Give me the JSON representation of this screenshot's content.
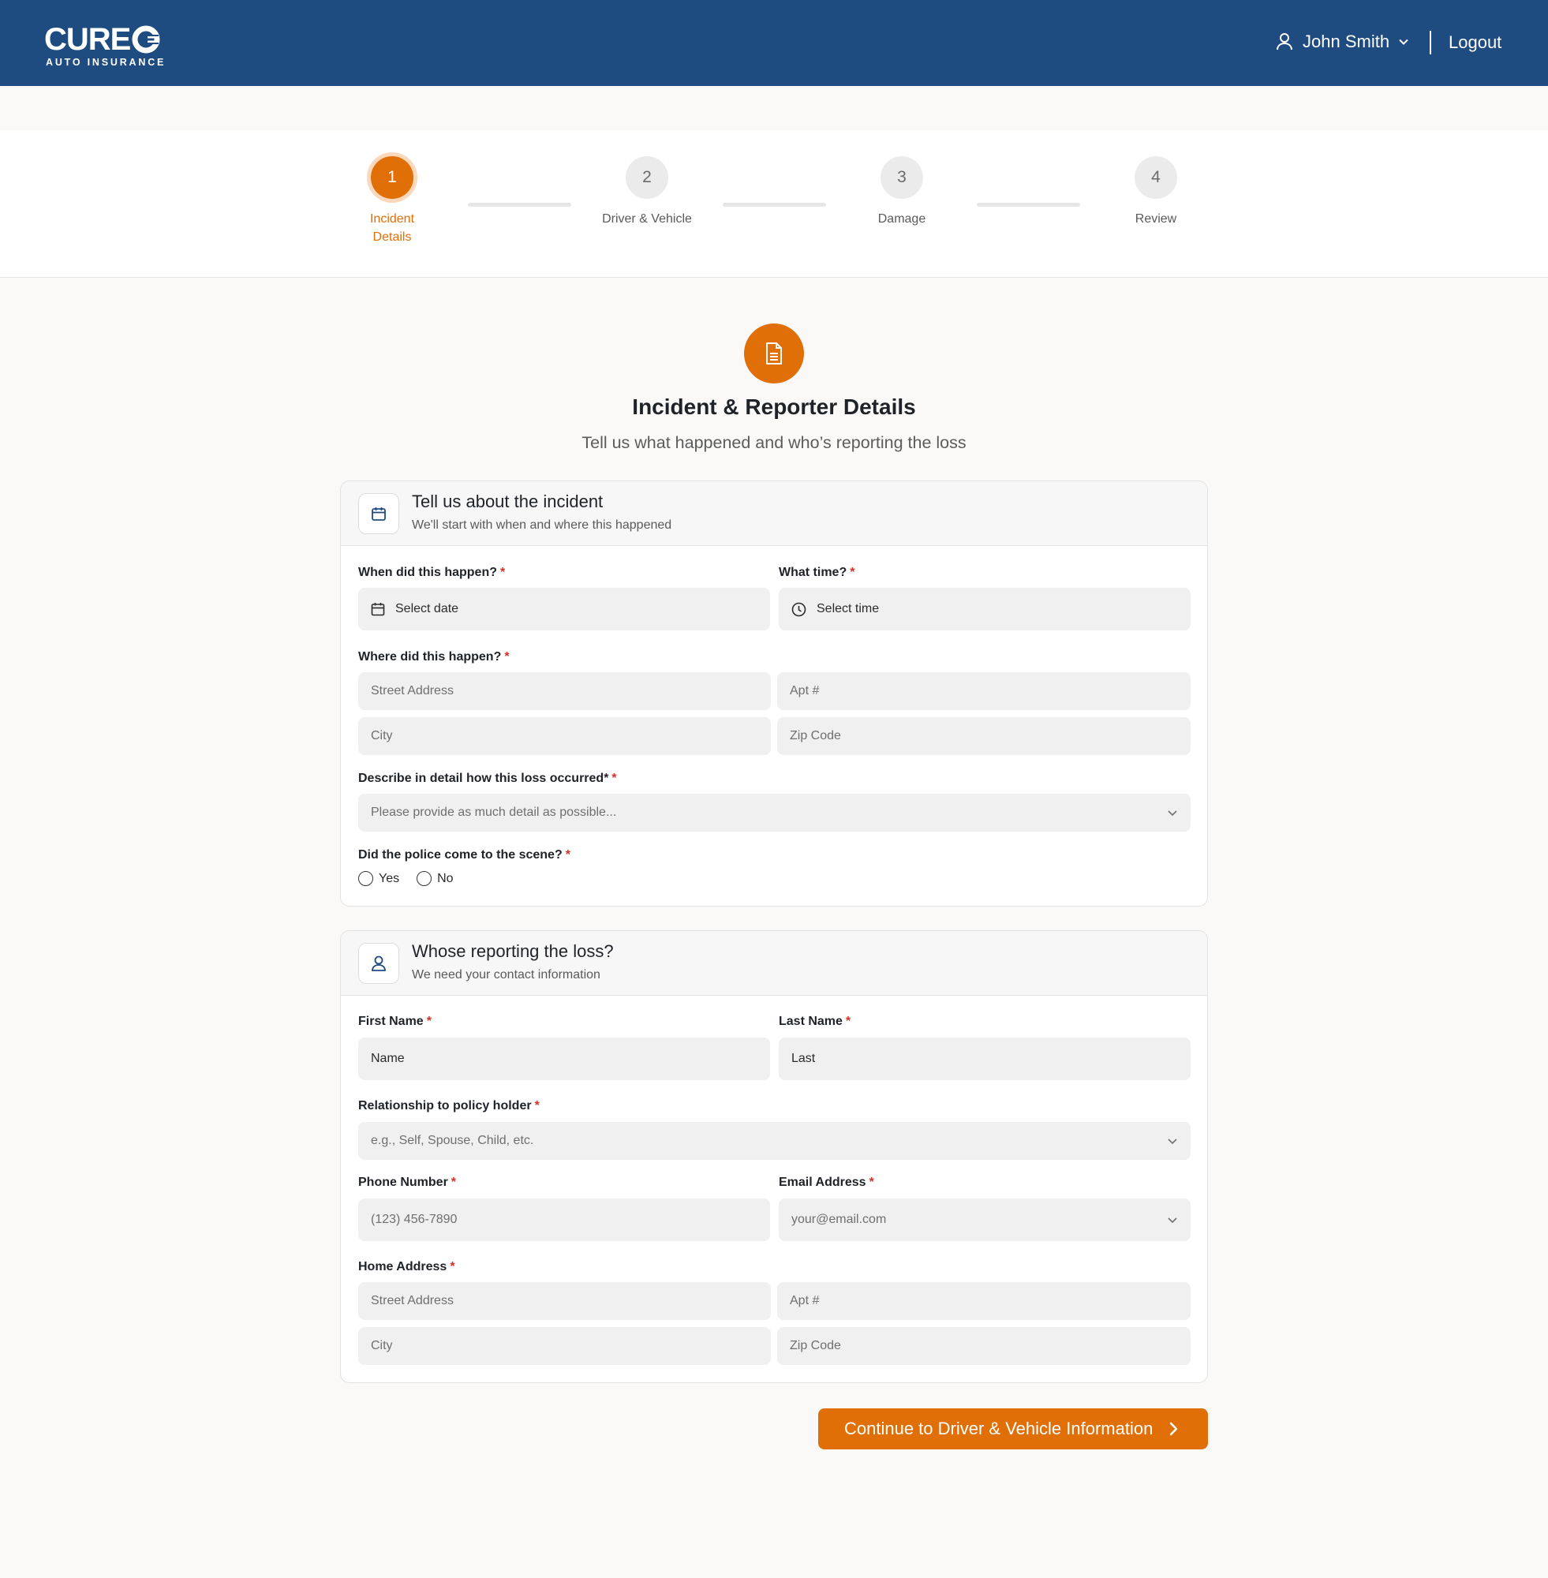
{
  "brand": {
    "name": "CURE",
    "tagline": "AUTO INSURANCE"
  },
  "header": {
    "user_name": "John Smith",
    "logout_label": "Logout"
  },
  "colors": {
    "header_bg": "#1e4b80",
    "accent": "#e06f08",
    "required": "#d93025"
  },
  "stepper": {
    "steps": [
      {
        "number": "1",
        "label": "Incident\nDetails",
        "state": "active"
      },
      {
        "number": "2",
        "label": "Driver & Vehicle",
        "state": "upcoming"
      },
      {
        "number": "3",
        "label": "Damage",
        "state": "upcoming"
      },
      {
        "number": "4",
        "label": "Review",
        "state": "upcoming"
      }
    ]
  },
  "hero": {
    "icon": "document-icon",
    "title": "Incident & Reporter Details",
    "subtitle": "Tell us what happened and who’s reporting the loss"
  },
  "incident_card": {
    "icon": "calendar-icon",
    "title": "Tell us about the incident",
    "subtitle": "We'll start with when and where this happened",
    "when_label": "When did this happen?",
    "date_placeholder": "Select date",
    "time_label": "What time?",
    "time_placeholder": "Select time",
    "where_label": "Where did this happen?",
    "street_placeholder": "Street Address",
    "apt_placeholder": "Apt #",
    "city_placeholder": "City",
    "zip_placeholder": "Zip Code",
    "describe_label": "Describe in detail how this loss occurred*",
    "describe_placeholder": "Please provide as much detail as possible...",
    "police_label": "Did the police come to the scene?",
    "police_options": [
      "Yes",
      "No"
    ]
  },
  "reporter_card": {
    "icon": "user-icon",
    "title": "Whose reporting the loss?",
    "subtitle": "We need your contact information",
    "first_name_label": "First Name",
    "first_name_value": "Name",
    "last_name_label": "Last Name",
    "last_name_value": "Last",
    "relationship_label": "Relationship to policy holder",
    "relationship_placeholder": "e.g., Self, Spouse, Child, etc.",
    "phone_label": "Phone Number",
    "phone_placeholder": "(123) 456-7890",
    "email_label": "Email Address",
    "email_placeholder": "your@email.com",
    "home_label": "Home Address",
    "street_placeholder": "Street Address",
    "apt_placeholder": "Apt #",
    "city_placeholder": "City",
    "zip_placeholder": "Zip Code"
  },
  "footer": {
    "continue_label": "Continue to Driver & Vehicle Information"
  }
}
